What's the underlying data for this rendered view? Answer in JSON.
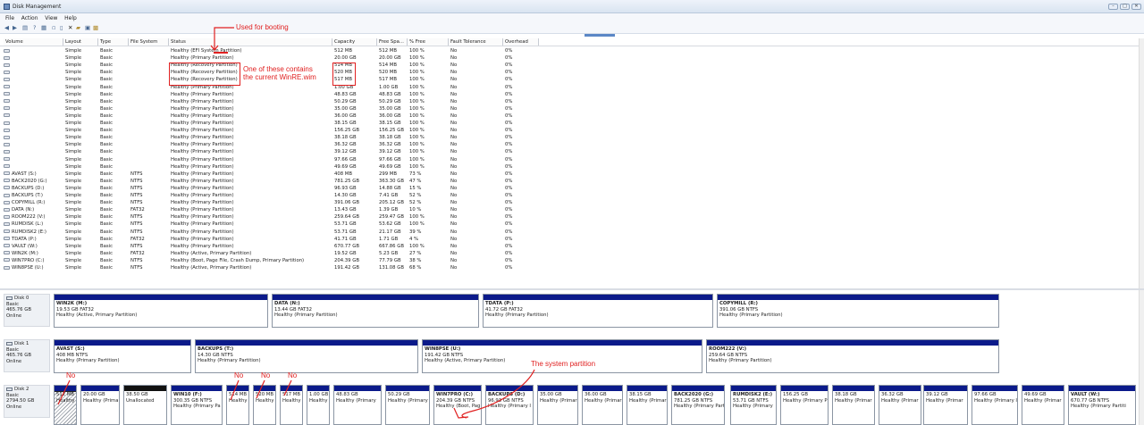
{
  "window": {
    "title": "Disk Management",
    "buttons": [
      "–",
      "□",
      "✕"
    ]
  },
  "menu": [
    "File",
    "Action",
    "View",
    "Help"
  ],
  "toolbar_icons": [
    "back-icon",
    "forward-icon",
    "console-tree-icon",
    "help-icon",
    "properties-icon",
    "refresh-icon",
    "delete-icon",
    "cancel-icon",
    "open-icon",
    "explore-icon",
    "help-book-icon"
  ],
  "columns": [
    "Volume",
    "Layout",
    "Type",
    "File System",
    "Status",
    "Capacity",
    "Free Spa...",
    "% Free",
    "Fault Tolerance",
    "Overhead"
  ],
  "volumes": [
    [
      "",
      "Simple",
      "Basic",
      "",
      "Healthy (EFI System Partition)",
      "512 MB",
      "512 MB",
      "100 %",
      "No",
      "0%"
    ],
    [
      "",
      "Simple",
      "Basic",
      "",
      "Healthy (Primary Partition)",
      "20.00 GB",
      "20.00 GB",
      "100 %",
      "No",
      "0%"
    ],
    [
      "",
      "Simple",
      "Basic",
      "",
      "Healthy (Recovery Partition)",
      "514 MB",
      "514 MB",
      "100 %",
      "No",
      "0%"
    ],
    [
      "",
      "Simple",
      "Basic",
      "",
      "Healthy (Recovery Partition)",
      "520 MB",
      "520 MB",
      "100 %",
      "No",
      "0%"
    ],
    [
      "",
      "Simple",
      "Basic",
      "",
      "Healthy (Recovery Partition)",
      "517 MB",
      "517 MB",
      "100 %",
      "No",
      "0%"
    ],
    [
      "",
      "Simple",
      "Basic",
      "",
      "Healthy (Primary Partition)",
      "1.00 GB",
      "1.00 GB",
      "100 %",
      "No",
      "0%"
    ],
    [
      "",
      "Simple",
      "Basic",
      "",
      "Healthy (Primary Partition)",
      "48.83 GB",
      "48.83 GB",
      "100 %",
      "No",
      "0%"
    ],
    [
      "",
      "Simple",
      "Basic",
      "",
      "Healthy (Primary Partition)",
      "50.29 GB",
      "50.29 GB",
      "100 %",
      "No",
      "0%"
    ],
    [
      "",
      "Simple",
      "Basic",
      "",
      "Healthy (Primary Partition)",
      "35.00 GB",
      "35.00 GB",
      "100 %",
      "No",
      "0%"
    ],
    [
      "",
      "Simple",
      "Basic",
      "",
      "Healthy (Primary Partition)",
      "36.00 GB",
      "36.00 GB",
      "100 %",
      "No",
      "0%"
    ],
    [
      "",
      "Simple",
      "Basic",
      "",
      "Healthy (Primary Partition)",
      "38.15 GB",
      "38.15 GB",
      "100 %",
      "No",
      "0%"
    ],
    [
      "",
      "Simple",
      "Basic",
      "",
      "Healthy (Primary Partition)",
      "156.25 GB",
      "156.25 GB",
      "100 %",
      "No",
      "0%"
    ],
    [
      "",
      "Simple",
      "Basic",
      "",
      "Healthy (Primary Partition)",
      "38.18 GB",
      "38.18 GB",
      "100 %",
      "No",
      "0%"
    ],
    [
      "",
      "Simple",
      "Basic",
      "",
      "Healthy (Primary Partition)",
      "36.32 GB",
      "36.32 GB",
      "100 %",
      "No",
      "0%"
    ],
    [
      "",
      "Simple",
      "Basic",
      "",
      "Healthy (Primary Partition)",
      "39.12 GB",
      "39.12 GB",
      "100 %",
      "No",
      "0%"
    ],
    [
      "",
      "Simple",
      "Basic",
      "",
      "Healthy (Primary Partition)",
      "97.66 GB",
      "97.66 GB",
      "100 %",
      "No",
      "0%"
    ],
    [
      "",
      "Simple",
      "Basic",
      "",
      "Healthy (Primary Partition)",
      "49.69 GB",
      "49.69 GB",
      "100 %",
      "No",
      "0%"
    ],
    [
      "AVAST (S:)",
      "Simple",
      "Basic",
      "NTFS",
      "Healthy (Primary Partition)",
      "408 MB",
      "299 MB",
      "73 %",
      "No",
      "0%"
    ],
    [
      "BACK2020 (G:)",
      "Simple",
      "Basic",
      "NTFS",
      "Healthy (Primary Partition)",
      "781.25 GB",
      "363.30 GB",
      "47 %",
      "No",
      "0%"
    ],
    [
      "BACKUPS (D:)",
      "Simple",
      "Basic",
      "NTFS",
      "Healthy (Primary Partition)",
      "96.93 GB",
      "14.88 GB",
      "15 %",
      "No",
      "0%"
    ],
    [
      "BACKUPS (T:)",
      "Simple",
      "Basic",
      "NTFS",
      "Healthy (Primary Partition)",
      "14.30 GB",
      "7.41 GB",
      "52 %",
      "No",
      "0%"
    ],
    [
      "COPYMILL (R:)",
      "Simple",
      "Basic",
      "NTFS",
      "Healthy (Primary Partition)",
      "391.06 GB",
      "205.12 GB",
      "52 %",
      "No",
      "0%"
    ],
    [
      "DATA (N:)",
      "Simple",
      "Basic",
      "FAT32",
      "Healthy (Primary Partition)",
      "13.43 GB",
      "1.39 GB",
      "10 %",
      "No",
      "0%"
    ],
    [
      "ROOM222 (V:)",
      "Simple",
      "Basic",
      "NTFS",
      "Healthy (Primary Partition)",
      "259.64 GB",
      "259.47 GB",
      "100 %",
      "No",
      "0%"
    ],
    [
      "RUMDISK (L:)",
      "Simple",
      "Basic",
      "NTFS",
      "Healthy (Primary Partition)",
      "53.71 GB",
      "53.62 GB",
      "100 %",
      "No",
      "0%"
    ],
    [
      "RUMDISK2 (E:)",
      "Simple",
      "Basic",
      "NTFS",
      "Healthy (Primary Partition)",
      "53.71 GB",
      "21.17 GB",
      "39 %",
      "No",
      "0%"
    ],
    [
      "TDATA (P:)",
      "Simple",
      "Basic",
      "FAT32",
      "Healthy (Primary Partition)",
      "41.71 GB",
      "1.71 GB",
      "4 %",
      "No",
      "0%"
    ],
    [
      "VAULT (W:)",
      "Simple",
      "Basic",
      "NTFS",
      "Healthy (Primary Partition)",
      "670.77 GB",
      "667.86 GB",
      "100 %",
      "No",
      "0%"
    ],
    [
      "WIN2K (M:)",
      "Simple",
      "Basic",
      "FAT32",
      "Healthy (Active, Primary Partition)",
      "19.52 GB",
      "5.23 GB",
      "27 %",
      "No",
      "0%"
    ],
    [
      "WIN7PRO (C:)",
      "Simple",
      "Basic",
      "NTFS",
      "Healthy (Boot, Page File, Crash Dump, Primary Partition)",
      "204.39 GB",
      "77.79 GB",
      "38 %",
      "No",
      "0%"
    ],
    [
      "WIN8PSE (U:)",
      "Simple",
      "Basic",
      "NTFS",
      "Healthy (Active, Primary Partition)",
      "191.42 GB",
      "131.08 GB",
      "68 %",
      "No",
      "0%"
    ]
  ],
  "disks": [
    {
      "name": "Disk 0",
      "type": "Basic",
      "size": "465.76 GB",
      "status": "Online",
      "partitions": [
        {
          "l1": "WIN2K  (M:)",
          "l2": "19.53 GB FAT32",
          "l3": "Healthy (Active, Primary Partition)"
        },
        {
          "l1": "DATA  (N:)",
          "l2": "13.44 GB FAT32",
          "l3": "Healthy (Primary Partition)"
        },
        {
          "l1": "TDATA  (P:)",
          "l2": "41.72 GB FAT32",
          "l3": "Healthy (Primary Partition)"
        },
        {
          "l1": "COPYMILL  (R:)",
          "l2": "391.06 GB NTFS",
          "l3": "Healthy (Primary Partition)"
        }
      ]
    },
    {
      "name": "Disk 1",
      "type": "Basic",
      "size": "465.76 GB",
      "status": "Online",
      "partitions": [
        {
          "l1": "AVAST  (S:)",
          "l2": "408 MB NTFS",
          "l3": "Healthy (Primary Partition)"
        },
        {
          "l1": "BACKUPS  (T:)",
          "l2": "14.30 GB NTFS",
          "l3": "Healthy (Primary Partition)"
        },
        {
          "l1": "WIN8PSE  (U:)",
          "l2": "191.42 GB NTFS",
          "l3": "Healthy (Active, Primary Partition)"
        },
        {
          "l1": "ROOM222  (V:)",
          "l2": "259.64 GB NTFS",
          "l3": "Healthy (Primary Partition)"
        }
      ]
    },
    {
      "name": "Disk 2",
      "type": "Basic",
      "size": "2794.50 GB",
      "status": "Online",
      "partitions": [
        {
          "l1": "",
          "l2": "512 MB",
          "l3": "Healthy"
        },
        {
          "l1": "",
          "l2": "20.00 GB",
          "l3": "Healthy (Prima"
        },
        {
          "l1": "",
          "l2": "38.50 GB",
          "l3": "Unallocated"
        },
        {
          "l1": "WIN10  (F:)",
          "l2": "300.35 GB NTFS",
          "l3": "Healthy (Primary Pa"
        },
        {
          "l1": "",
          "l2": "514 MB",
          "l3": "Healthy"
        },
        {
          "l1": "",
          "l2": "520 MB",
          "l3": "Healthy"
        },
        {
          "l1": "",
          "l2": "517 MB",
          "l3": "Healthy"
        },
        {
          "l1": "",
          "l2": "1.00 GB",
          "l3": "Healthy (I"
        },
        {
          "l1": "",
          "l2": "48.83 GB",
          "l3": "Healthy (Primary"
        },
        {
          "l1": "",
          "l2": "50.29 GB",
          "l3": "Healthy (Primary"
        },
        {
          "l1": "WIN7PRO  (C:)",
          "l2": "204.39 GB NTFS",
          "l3": "Healthy (Boot, Pag"
        },
        {
          "l1": "BACKUPS  (D:)",
          "l2": "96.93 GB NTFS",
          "l3": "Healthy (Primary I"
        },
        {
          "l1": "",
          "l2": "35.00 GB",
          "l3": "Healthy (Primar"
        },
        {
          "l1": "",
          "l2": "36.00 GB",
          "l3": "Healthy (Primar"
        },
        {
          "l1": "",
          "l2": "38.15 GB",
          "l3": "Healthy (Primar"
        },
        {
          "l1": "BACK2020  (G:)",
          "l2": "781.25 GB NTFS",
          "l3": "Healthy (Primary Part"
        },
        {
          "l1": "RUMDISK2  (E:)",
          "l2": "53.71 GB NTFS",
          "l3": "Healthy (Primary"
        },
        {
          "l1": "",
          "l2": "156.25 GB",
          "l3": "Healthy (Primary P"
        },
        {
          "l1": "",
          "l2": "38.18 GB",
          "l3": "Healthy (Primar"
        },
        {
          "l1": "",
          "l2": "36.32 GB",
          "l3": "Healthy (Primar"
        },
        {
          "l1": "",
          "l2": "39.12 GB",
          "l3": "Healthy (Primar"
        },
        {
          "l1": "",
          "l2": "97.66 GB",
          "l3": "Healthy (Primary I"
        },
        {
          "l1": "",
          "l2": "49.69 GB",
          "l3": "Healthy (Primar"
        },
        {
          "l1": "VAULT  (W:)",
          "l2": "670.77 GB NTFS",
          "l3": "Healthy (Primary Partiti"
        }
      ]
    }
  ],
  "annotations": {
    "booting": "Used for booting",
    "winre_1": "One of these contains",
    "winre_2": "the current WinRE.wim",
    "no": "No",
    "system": "The system partition"
  },
  "colors": {
    "annotation": "#e02020",
    "partition_bar": "#0b1a8a",
    "unallocated_bar": "#111111"
  }
}
